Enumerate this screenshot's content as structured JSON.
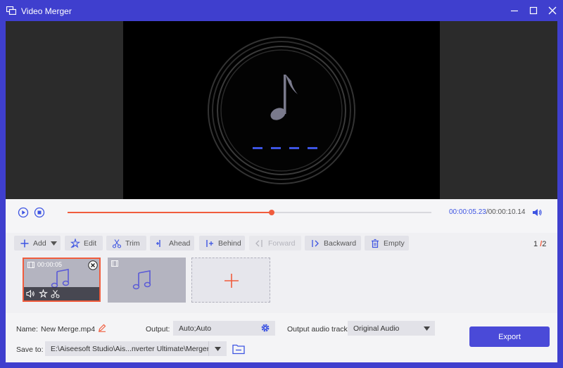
{
  "window": {
    "title": "Video Merger",
    "controls": [
      "minimize-icon",
      "maximize-icon",
      "close-icon"
    ]
  },
  "preview": {
    "icon": "music-note-icon"
  },
  "playback": {
    "current_time": "00:00:05.23",
    "separator": "/",
    "total_time": "00:00:10.14",
    "progress": 0.56
  },
  "toolbar": {
    "add_label": "Add",
    "edit_label": "Edit",
    "trim_label": "Trim",
    "ahead_label": "Ahead",
    "behind_label": "Behind",
    "forward_label": "Forward",
    "backward_label": "Backward",
    "empty_label": "Empty",
    "page_current": "1",
    "page_sep": "/",
    "page_total": "2"
  },
  "clips": [
    {
      "duration": "00:00:05",
      "selected": true
    },
    {
      "duration": "",
      "selected": false
    }
  ],
  "settings": {
    "name_label": "Name:",
    "name_value": "New Merge.mp4",
    "output_label": "Output:",
    "output_value": "Auto;Auto",
    "audio_track_label": "Output audio track:",
    "audio_track_value": "Original Audio",
    "save_to_label": "Save to:",
    "save_to_value": "E:\\Aiseesoft Studio\\Ais...nverter Ultimate\\Merger",
    "export_label": "Export"
  },
  "colors": {
    "accent": "#3d54e2",
    "highlight": "#f05c3d",
    "titlebar": "#3f3fce",
    "export": "#4a4ad8"
  }
}
